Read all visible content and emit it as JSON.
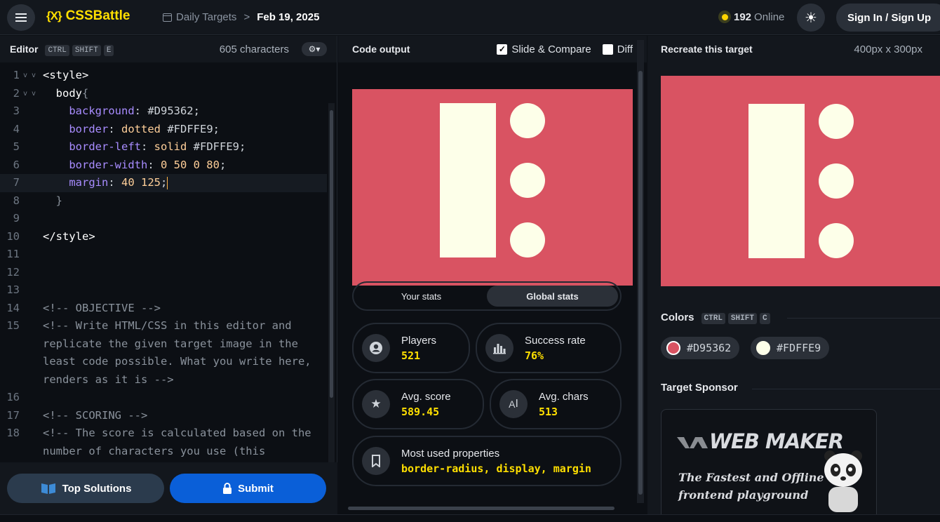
{
  "header": {
    "logo_mark": "{X}",
    "logo_text": "CSSBattle",
    "breadcrumb_section": "Daily Targets",
    "breadcrumb_sep": ">",
    "breadcrumb_date": "Feb 19, 2025",
    "online_count": "192",
    "online_label": "Online",
    "sign_in_label": "Sign In / Sign Up"
  },
  "editor": {
    "title": "Editor",
    "shortcut": [
      "CTRL",
      "SHIFT",
      "E"
    ],
    "char_count": "605 characters",
    "lines": [
      {
        "n": "1",
        "parts": [
          [
            "tag",
            "<style>"
          ]
        ],
        "fold": "v v"
      },
      {
        "n": "2",
        "parts": [
          [
            "tag",
            "  body"
          ],
          [
            "cmt",
            "{"
          ]
        ],
        "fold": "v v"
      },
      {
        "n": "3",
        "parts": [
          [
            "prop",
            "    background"
          ],
          [
            "hex",
            ": #D95362;"
          ]
        ]
      },
      {
        "n": "4",
        "parts": [
          [
            "prop",
            "    border"
          ],
          [
            "hex",
            ": "
          ],
          [
            "val",
            "dotted"
          ],
          [
            "hex",
            " #FDFFE9;"
          ]
        ]
      },
      {
        "n": "5",
        "parts": [
          [
            "prop",
            "    border-left"
          ],
          [
            "hex",
            ": "
          ],
          [
            "val",
            "solid"
          ],
          [
            "hex",
            " #FDFFE9;"
          ]
        ]
      },
      {
        "n": "6",
        "parts": [
          [
            "prop",
            "    border-width"
          ],
          [
            "hex",
            ": "
          ],
          [
            "val",
            "0 50 0 80"
          ],
          [
            "hex",
            ";"
          ]
        ]
      },
      {
        "n": "7",
        "parts": [
          [
            "prop",
            "    margin"
          ],
          [
            "hex",
            ": "
          ],
          [
            "val",
            "40 125"
          ],
          [
            "hex",
            ";"
          ]
        ],
        "active": true
      },
      {
        "n": "8",
        "parts": [
          [
            "cmt",
            "  }"
          ]
        ]
      },
      {
        "n": "9",
        "parts": []
      },
      {
        "n": "10",
        "parts": [
          [
            "tag",
            "</style>"
          ]
        ]
      },
      {
        "n": "11",
        "parts": []
      },
      {
        "n": "12",
        "parts": []
      },
      {
        "n": "13",
        "parts": []
      },
      {
        "n": "14",
        "parts": [
          [
            "cmt",
            "<!-- OBJECTIVE -->"
          ]
        ]
      },
      {
        "n": "15",
        "parts": [
          [
            "cmt",
            "<!-- Write HTML/CSS in this editor and replicate the given target image in the least code possible. What you write here, renders as it is -->"
          ]
        ],
        "rows": 4
      },
      {
        "n": "16",
        "parts": []
      },
      {
        "n": "17",
        "parts": [
          [
            "cmt",
            "<!-- SCORING -->"
          ]
        ]
      },
      {
        "n": "18",
        "parts": [
          [
            "cmt",
            "<!-- The score is calculated based on the number of characters you use (this"
          ]
        ],
        "rows": 2
      }
    ],
    "top_solutions_label": "Top Solutions",
    "submit_label": "Submit"
  },
  "output": {
    "title": "Code output",
    "slide_compare_label": "Slide & Compare",
    "diff_label": "Diff",
    "tabs": [
      "Your stats",
      "Global stats"
    ],
    "stats": {
      "players_label": "Players",
      "players_value": "521",
      "success_label": "Success rate",
      "success_value": "76%",
      "avg_score_label": "Avg. score",
      "avg_score_value": "589.45",
      "avg_chars_label": "Avg. chars",
      "avg_chars_value": "513",
      "most_used_label": "Most used properties",
      "most_used_value": "border-radius, display, margin"
    }
  },
  "target": {
    "title": "Recreate this target",
    "size": "400px x 300px",
    "colors_title": "Colors",
    "colors_shortcut": [
      "CTRL",
      "SHIFT",
      "C"
    ],
    "colors": [
      {
        "hex": "#D95362",
        "swatch": "#d95362"
      },
      {
        "hex": "#FDFFE9",
        "swatch": "#fdffe9"
      }
    ],
    "sponsor_title": "Target Sponsor",
    "sponsor_name": "WEB MAKER",
    "sponsor_tagline": "The Fastest and Offline frontend playground"
  },
  "icons": {
    "menu": "menu-icon",
    "calendar": "calendar-icon",
    "theme": "sun-icon",
    "settings": "gear-icon",
    "book": "book-icon",
    "lock": "lock-icon",
    "user": "user-icon",
    "chart": "bar-chart-icon",
    "star": "star-icon",
    "text": "text-cursor-icon",
    "bookmark": "bookmark-icon"
  },
  "colors": {
    "accent": "#ffdf00",
    "submit": "#0a5fd8",
    "target_bg": "#d95362",
    "target_fg": "#fdffe9"
  }
}
